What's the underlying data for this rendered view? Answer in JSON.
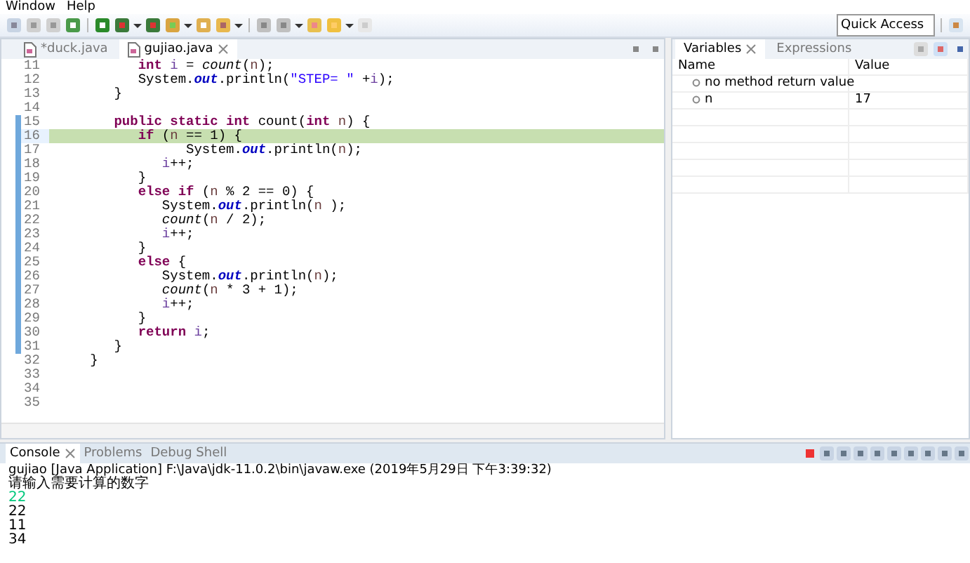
{
  "menu": [
    {
      "label": "Window"
    },
    {
      "label": "Help"
    }
  ],
  "quick_access": {
    "placeholder": "Quick Access"
  },
  "editor_tabs": [
    {
      "label": "*duck.java",
      "selected": false
    },
    {
      "label": "gujiao.java",
      "selected": true
    }
  ],
  "code_lines": [
    {
      "number": "11",
      "current": false,
      "tokens": [
        {
          "kind": "keyword",
          "text": "\t\t\tint"
        },
        {
          "kind": "local",
          "text": " i"
        },
        {
          "kind": "plain",
          "text": " = "
        },
        {
          "kind": "method",
          "text": "count"
        },
        {
          "kind": "plain",
          "text": "("
        },
        {
          "kind": "param",
          "text": "n"
        },
        {
          "kind": "plain",
          "text": ");"
        }
      ]
    },
    {
      "number": "12",
      "current": false,
      "tokens": [
        {
          "kind": "plain",
          "text": "\t\t\tSystem."
        },
        {
          "kind": "field",
          "text": "out"
        },
        {
          "kind": "plain",
          "text": ".println("
        },
        {
          "kind": "string",
          "text": "\"STEP= \""
        },
        {
          "kind": "plain",
          "text": " +"
        },
        {
          "kind": "local",
          "text": "i"
        },
        {
          "kind": "plain",
          "text": ");"
        }
      ]
    },
    {
      "number": "13",
      "current": false,
      "tokens": [
        {
          "kind": "plain",
          "text": "\t\t}"
        }
      ]
    },
    {
      "number": "14",
      "current": false
    },
    {
      "number": "15",
      "current": false,
      "tokens": [
        {
          "kind": "keyword",
          "text": "\t\tpublic static int"
        },
        {
          "kind": "plain",
          "text": " count("
        },
        {
          "kind": "keyword",
          "text": "int"
        },
        {
          "kind": "param",
          "text": " n"
        },
        {
          "kind": "plain",
          "text": ") {"
        }
      ]
    },
    {
      "number": "16",
      "current": true,
      "tokens": [
        {
          "kind": "keyword",
          "text": "\t\t\tif"
        },
        {
          "kind": "plain",
          "text": " ("
        },
        {
          "kind": "param",
          "text": "n"
        },
        {
          "kind": "plain",
          "text": " == 1) {"
        }
      ]
    },
    {
      "number": "17",
      "current": false,
      "tokens": [
        {
          "kind": "plain",
          "text": "\t\t\t\t\tSystem."
        },
        {
          "kind": "field",
          "text": "out"
        },
        {
          "kind": "plain",
          "text": ".println("
        },
        {
          "kind": "param",
          "text": "n"
        },
        {
          "kind": "plain",
          "text": ");"
        }
      ]
    },
    {
      "number": "18",
      "current": false,
      "tokens": [
        {
          "kind": "local",
          "text": "\t\t\t\ti"
        },
        {
          "kind": "plain",
          "text": "++;"
        }
      ]
    },
    {
      "number": "19",
      "current": false,
      "tokens": [
        {
          "kind": "plain",
          "text": "\t\t\t}"
        }
      ]
    },
    {
      "number": "20",
      "current": false,
      "tokens": [
        {
          "kind": "keyword",
          "text": "\t\t\telse if"
        },
        {
          "kind": "plain",
          "text": " ("
        },
        {
          "kind": "param",
          "text": "n"
        },
        {
          "kind": "plain",
          "text": " % 2 == 0) {"
        }
      ]
    },
    {
      "number": "21",
      "current": false,
      "tokens": [
        {
          "kind": "plain",
          "text": "\t\t\t\tSystem."
        },
        {
          "kind": "field",
          "text": "out"
        },
        {
          "kind": "plain",
          "text": ".println("
        },
        {
          "kind": "param",
          "text": "n"
        },
        {
          "kind": "plain",
          "text": " );"
        }
      ]
    },
    {
      "number": "22",
      "current": false,
      "tokens": [
        {
          "kind": "method",
          "text": "\t\t\t\tcount"
        },
        {
          "kind": "plain",
          "text": "("
        },
        {
          "kind": "param",
          "text": "n"
        },
        {
          "kind": "plain",
          "text": " / 2);"
        }
      ]
    },
    {
      "number": "23",
      "current": false,
      "tokens": [
        {
          "kind": "local",
          "text": "\t\t\t\ti"
        },
        {
          "kind": "plain",
          "text": "++;"
        }
      ]
    },
    {
      "number": "24",
      "current": false,
      "tokens": [
        {
          "kind": "plain",
          "text": "\t\t\t}"
        }
      ]
    },
    {
      "number": "25",
      "current": false,
      "tokens": [
        {
          "kind": "keyword",
          "text": "\t\t\telse"
        },
        {
          "kind": "plain",
          "text": " {"
        }
      ]
    },
    {
      "number": "26",
      "current": false,
      "tokens": [
        {
          "kind": "plain",
          "text": "\t\t\t\tSystem."
        },
        {
          "kind": "field",
          "text": "out"
        },
        {
          "kind": "plain",
          "text": ".println("
        },
        {
          "kind": "param",
          "text": "n"
        },
        {
          "kind": "plain",
          "text": ");"
        }
      ]
    },
    {
      "number": "27",
      "current": false,
      "tokens": [
        {
          "kind": "method",
          "text": "\t\t\t\tcount"
        },
        {
          "kind": "plain",
          "text": "("
        },
        {
          "kind": "param",
          "text": "n"
        },
        {
          "kind": "plain",
          "text": " * 3 + 1);"
        }
      ]
    },
    {
      "number": "28",
      "current": false,
      "tokens": [
        {
          "kind": "local",
          "text": "\t\t\t\ti"
        },
        {
          "kind": "plain",
          "text": "++;"
        }
      ]
    },
    {
      "number": "29",
      "current": false,
      "tokens": [
        {
          "kind": "plain",
          "text": "\t\t\t}"
        }
      ]
    },
    {
      "number": "30",
      "current": false,
      "tokens": [
        {
          "kind": "keyword",
          "text": "\t\t\treturn"
        },
        {
          "kind": "local",
          "text": " i"
        },
        {
          "kind": "plain",
          "text": ";"
        }
      ]
    },
    {
      "number": "31",
      "current": false,
      "tokens": [
        {
          "kind": "plain",
          "text": "\t\t}"
        }
      ]
    },
    {
      "number": "32",
      "current": false,
      "tokens": [
        {
          "kind": "plain",
          "text": "\t}"
        }
      ]
    },
    {
      "number": "33",
      "current": false
    },
    {
      "number": "34",
      "current": false
    },
    {
      "number": "35",
      "current": false
    }
  ],
  "debug_tabs": [
    {
      "label": "Variables",
      "selected": true
    },
    {
      "label": "Expressions",
      "selected": false
    }
  ],
  "variables": {
    "columns": [
      "Name",
      "Value"
    ],
    "rows": [
      {
        "name": "no method return value",
        "value": ""
      },
      {
        "name": "n",
        "value": "17"
      }
    ]
  },
  "console_tabs": [
    {
      "label": "Console",
      "selected": true
    },
    {
      "label": "Problems",
      "selected": false
    },
    {
      "label": "Debug Shell",
      "selected": false
    }
  ],
  "console": {
    "header": "gujiao [Java Application] F:\\Java\\jdk-11.0.2\\bin\\javaw.exe (2019年5月29日 下午3:39:32)",
    "lines": [
      {
        "kind": "output",
        "text": "请输入需要计算的数字"
      },
      {
        "kind": "input",
        "text": "22"
      },
      {
        "kind": "output",
        "text": "22"
      },
      {
        "kind": "output",
        "text": "11"
      },
      {
        "kind": "output",
        "text": "34"
      }
    ]
  }
}
